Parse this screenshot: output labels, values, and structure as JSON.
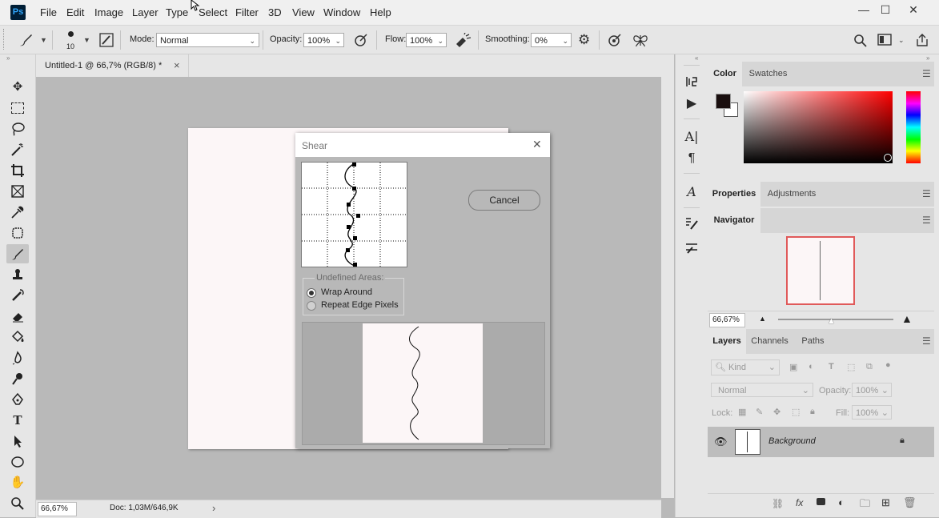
{
  "app": {
    "logo": "Ps"
  },
  "menu": [
    "File",
    "Edit",
    "Image",
    "Layer",
    "Type",
    "Select",
    "Filter",
    "3D",
    "View",
    "Window",
    "Help"
  ],
  "window_controls": {
    "minimize": "—",
    "maximize": "☐",
    "close": "✕"
  },
  "options_bar": {
    "brush_size": "10",
    "mode_label": "Mode:",
    "mode_value": "Normal",
    "opacity_label": "Opacity:",
    "opacity_value": "100%",
    "flow_label": "Flow:",
    "flow_value": "100%",
    "smoothing_label": "Smoothing:",
    "smoothing_value": "0%"
  },
  "document_tab": {
    "title": "Untitled-1 @ 66,7% (RGB/8) *",
    "close": "×"
  },
  "status_bar": {
    "zoom": "66,67%",
    "doc_info": "Doc: 1,03M/646,9K",
    "arrow": "›"
  },
  "dialog": {
    "title": "Shear",
    "close": "✕",
    "cancel_label": "Cancel",
    "group_label": "Undefined Areas:",
    "option_wrap": "Wrap Around",
    "option_repeat": "Repeat Edge Pixels",
    "selected_option": "Wrap Around"
  },
  "panels": {
    "color_tabs": [
      "Color",
      "Swatches"
    ],
    "properties_tabs": [
      "Properties",
      "Adjustments"
    ],
    "navigator_tab": "Navigator",
    "navigator_zoom": "66,67%",
    "layers_tabs": [
      "Layers",
      "Channels",
      "Paths"
    ],
    "layers_filter": "Kind",
    "layers_blend": "Normal",
    "layers_opacity_label": "Opacity:",
    "layers_opacity_value": "100%",
    "lock_label": "Lock:",
    "fill_label": "Fill:",
    "fill_value": "100%",
    "layer_name": "Background"
  },
  "colors": {
    "accent_navigator_frame": "#e05a5a",
    "foreground": "#1a0f0f",
    "background": "#ffffff",
    "document_fill": "#fcf6f7"
  }
}
